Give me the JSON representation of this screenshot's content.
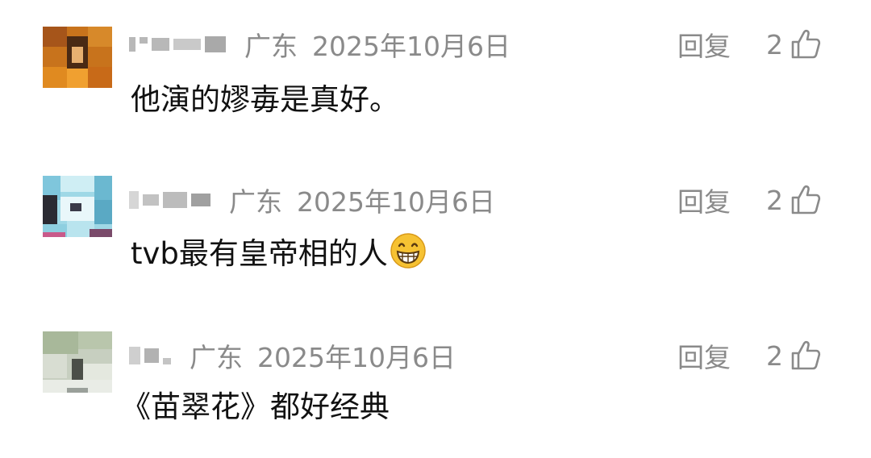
{
  "comments": [
    {
      "region": "广东",
      "date": "2025年10月6日",
      "reply_label": "回复",
      "like_count": "2",
      "text": "他演的嫪毐是真好。",
      "emoji": ""
    },
    {
      "region": "广东",
      "date": "2025年10月6日",
      "reply_label": "回复",
      "like_count": "2",
      "text": "tvb最有皇帝相的人",
      "emoji": "grinning-face-icon"
    },
    {
      "region": "广东",
      "date": "2025年10月6日",
      "reply_label": "回复",
      "like_count": "2",
      "text": "《苗翠花》都好经典",
      "emoji": ""
    }
  ],
  "colors": {
    "meta_text": "#8a8a8a",
    "body_text": "#111111",
    "emoji_fill": "#f6c233"
  }
}
